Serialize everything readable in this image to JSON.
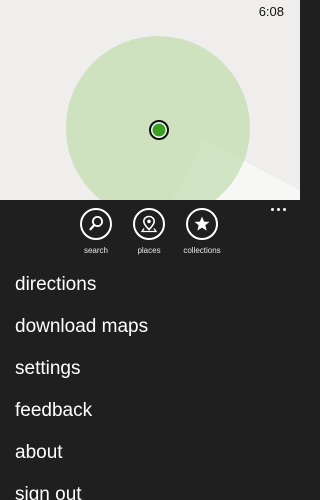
{
  "status": {
    "time": "6:08"
  },
  "map": {
    "accuracy_color": "#c4deb2",
    "location_color": "#3aa024"
  },
  "appbar": {
    "more_icon": "ellipsis-icon",
    "buttons": [
      {
        "label": "search",
        "icon": "search-icon"
      },
      {
        "label": "places",
        "icon": "places-pin-icon"
      },
      {
        "label": "collections",
        "icon": "star-icon"
      }
    ],
    "menu": [
      "directions",
      "download maps",
      "settings",
      "feedback",
      "about",
      "sign out"
    ]
  }
}
